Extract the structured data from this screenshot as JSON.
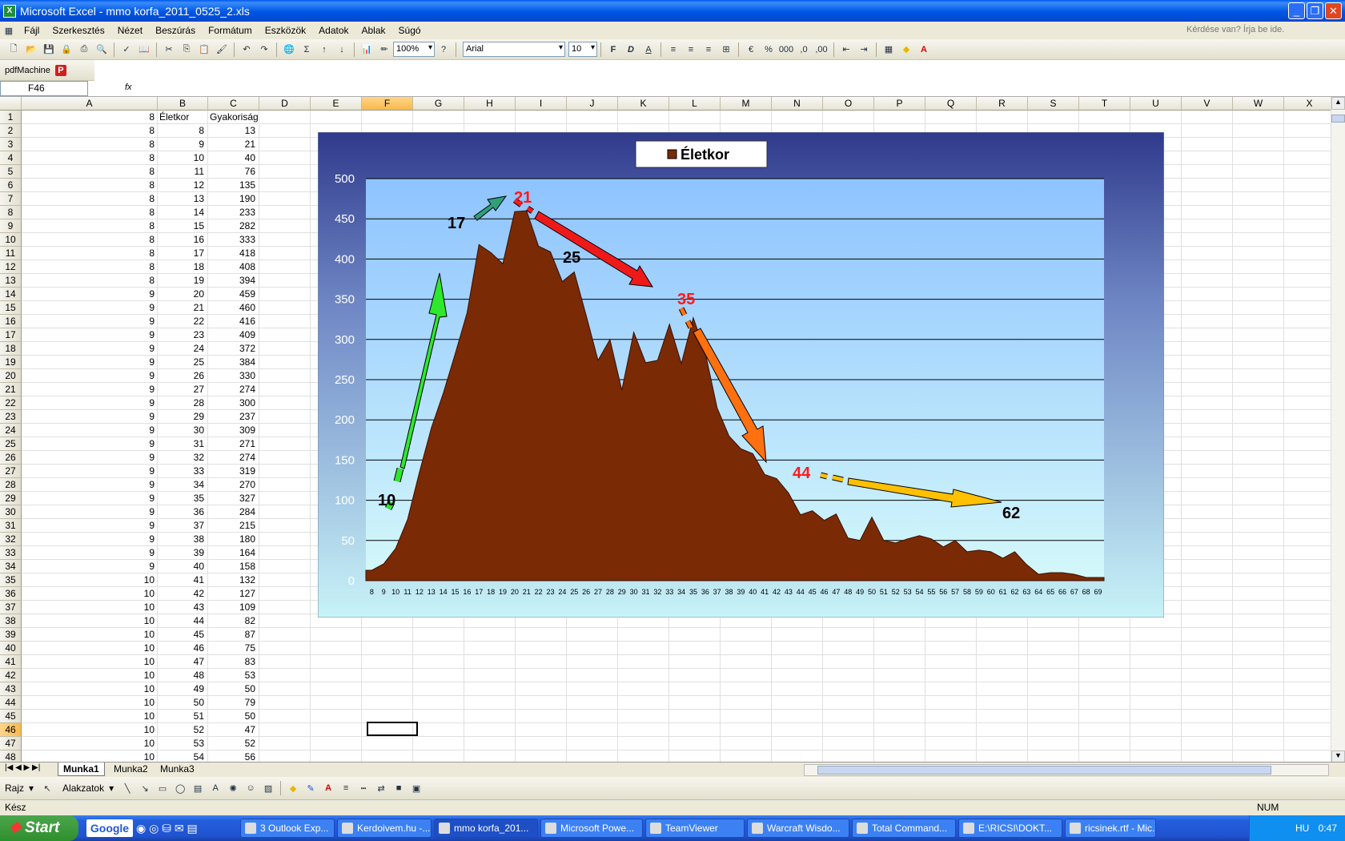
{
  "window": {
    "title": "Microsoft Excel - mmo korfa_2011_0525_2.xls",
    "app_icon": "X"
  },
  "menu": {
    "items": [
      "Fájl",
      "Szerkesztés",
      "Nézet",
      "Beszúrás",
      "Formátum",
      "Eszközök",
      "Adatok",
      "Ablak",
      "Súgó"
    ],
    "help_placeholder": "Kérdése van? Írja be ide."
  },
  "toolbar": {
    "zoom": "100%",
    "font": "Arial",
    "size": "10",
    "bold": "F",
    "italic": "D",
    "underline": "A",
    "pdf_label": "pdfMachine"
  },
  "formula_bar": {
    "name_box": "F46",
    "fx": "fx",
    "value": ""
  },
  "columns": [
    "A",
    "B",
    "C",
    "D",
    "E",
    "F",
    "G",
    "H",
    "I",
    "J",
    "K",
    "L",
    "M",
    "N",
    "O",
    "P",
    "Q",
    "R",
    "S",
    "T",
    "U",
    "V",
    "W",
    "X"
  ],
  "header_row": {
    "a": "8",
    "b": "Életkor",
    "c": "Gyakoriság"
  },
  "rows": [
    {
      "a": "8",
      "b": "8",
      "c": "13"
    },
    {
      "a": "8",
      "b": "9",
      "c": "21"
    },
    {
      "a": "8",
      "b": "10",
      "c": "40"
    },
    {
      "a": "8",
      "b": "11",
      "c": "76"
    },
    {
      "a": "8",
      "b": "12",
      "c": "135"
    },
    {
      "a": "8",
      "b": "13",
      "c": "190"
    },
    {
      "a": "8",
      "b": "14",
      "c": "233"
    },
    {
      "a": "8",
      "b": "15",
      "c": "282"
    },
    {
      "a": "8",
      "b": "16",
      "c": "333"
    },
    {
      "a": "8",
      "b": "17",
      "c": "418"
    },
    {
      "a": "8",
      "b": "18",
      "c": "408"
    },
    {
      "a": "8",
      "b": "19",
      "c": "394"
    },
    {
      "a": "9",
      "b": "20",
      "c": "459"
    },
    {
      "a": "9",
      "b": "21",
      "c": "460"
    },
    {
      "a": "9",
      "b": "22",
      "c": "416"
    },
    {
      "a": "9",
      "b": "23",
      "c": "409"
    },
    {
      "a": "9",
      "b": "24",
      "c": "372"
    },
    {
      "a": "9",
      "b": "25",
      "c": "384"
    },
    {
      "a": "9",
      "b": "26",
      "c": "330"
    },
    {
      "a": "9",
      "b": "27",
      "c": "274"
    },
    {
      "a": "9",
      "b": "28",
      "c": "300"
    },
    {
      "a": "9",
      "b": "29",
      "c": "237"
    },
    {
      "a": "9",
      "b": "30",
      "c": "309"
    },
    {
      "a": "9",
      "b": "31",
      "c": "271"
    },
    {
      "a": "9",
      "b": "32",
      "c": "274"
    },
    {
      "a": "9",
      "b": "33",
      "c": "319"
    },
    {
      "a": "9",
      "b": "34",
      "c": "270"
    },
    {
      "a": "9",
      "b": "35",
      "c": "327"
    },
    {
      "a": "9",
      "b": "36",
      "c": "284"
    },
    {
      "a": "9",
      "b": "37",
      "c": "215"
    },
    {
      "a": "9",
      "b": "38",
      "c": "180"
    },
    {
      "a": "9",
      "b": "39",
      "c": "164"
    },
    {
      "a": "9",
      "b": "40",
      "c": "158"
    },
    {
      "a": "10",
      "b": "41",
      "c": "132"
    },
    {
      "a": "10",
      "b": "42",
      "c": "127"
    },
    {
      "a": "10",
      "b": "43",
      "c": "109"
    },
    {
      "a": "10",
      "b": "44",
      "c": "82"
    },
    {
      "a": "10",
      "b": "45",
      "c": "87"
    },
    {
      "a": "10",
      "b": "46",
      "c": "75"
    },
    {
      "a": "10",
      "b": "47",
      "c": "83"
    },
    {
      "a": "10",
      "b": "48",
      "c": "53"
    },
    {
      "a": "10",
      "b": "49",
      "c": "50"
    },
    {
      "a": "10",
      "b": "50",
      "c": "79"
    },
    {
      "a": "10",
      "b": "51",
      "c": "50"
    },
    {
      "a": "10",
      "b": "52",
      "c": "47"
    },
    {
      "a": "10",
      "b": "53",
      "c": "52"
    },
    {
      "a": "10",
      "b": "54",
      "c": "56"
    }
  ],
  "chart_data": {
    "type": "area",
    "title": "",
    "legend": [
      "Életkor"
    ],
    "legend_position": "top",
    "ylim": [
      0,
      500
    ],
    "yticks": [
      0,
      50,
      100,
      150,
      200,
      250,
      300,
      350,
      400,
      450,
      500
    ],
    "x": [
      8,
      9,
      10,
      11,
      12,
      13,
      14,
      15,
      16,
      17,
      18,
      19,
      20,
      21,
      22,
      23,
      24,
      25,
      26,
      27,
      28,
      29,
      30,
      31,
      32,
      33,
      34,
      35,
      36,
      37,
      38,
      39,
      40,
      41,
      42,
      43,
      44,
      45,
      46,
      47,
      48,
      49,
      50,
      51,
      52,
      53,
      54,
      55,
      56,
      57,
      58,
      59,
      60,
      61,
      62,
      63,
      64,
      65,
      66,
      67,
      68,
      69
    ],
    "series": [
      {
        "name": "Életkor",
        "values": [
          13,
          21,
          40,
          76,
          135,
          190,
          233,
          282,
          333,
          418,
          408,
          394,
          459,
          460,
          416,
          409,
          372,
          384,
          330,
          274,
          300,
          237,
          309,
          271,
          274,
          319,
          270,
          327,
          284,
          215,
          180,
          164,
          158,
          132,
          127,
          109,
          82,
          87,
          75,
          83,
          53,
          50,
          79,
          50,
          47,
          52,
          56,
          52,
          42,
          50,
          36,
          38,
          36,
          28,
          36,
          20,
          8,
          10,
          10,
          8,
          4,
          4
        ]
      }
    ],
    "annotations": [
      {
        "text": "10",
        "color": "#000000"
      },
      {
        "text": "17",
        "color": "#000000"
      },
      {
        "text": "21",
        "color": "#ff1a1a"
      },
      {
        "text": "25",
        "color": "#000000"
      },
      {
        "text": "35",
        "color": "#ff1a1a"
      },
      {
        "text": "44",
        "color": "#ff1a1a"
      },
      {
        "text": "62",
        "color": "#000000"
      }
    ],
    "colors": {
      "area": "#7a2a05",
      "plot_bg": "#99ccff",
      "legend_swatch": "#7a2a05"
    }
  },
  "sheets": [
    "Munka1",
    "Munka2",
    "Munka3"
  ],
  "drawing": {
    "draw": "Rajz",
    "shapes": "Alakzatok"
  },
  "status": {
    "left": "Kész",
    "right": "NUM"
  },
  "taskbar": {
    "start": "Start",
    "search": "Google",
    "items": [
      "3 Outlook Exp...",
      "Kerdoivem.hu -...",
      "mmo korfa_201...",
      "Microsoft Powe...",
      "TeamViewer",
      "Warcraft Wisdo...",
      "Total Command...",
      "E:\\RICSI\\DOKT...",
      "ricsinek.rtf - Mic..."
    ],
    "lang": "HU",
    "time": "0:47"
  }
}
